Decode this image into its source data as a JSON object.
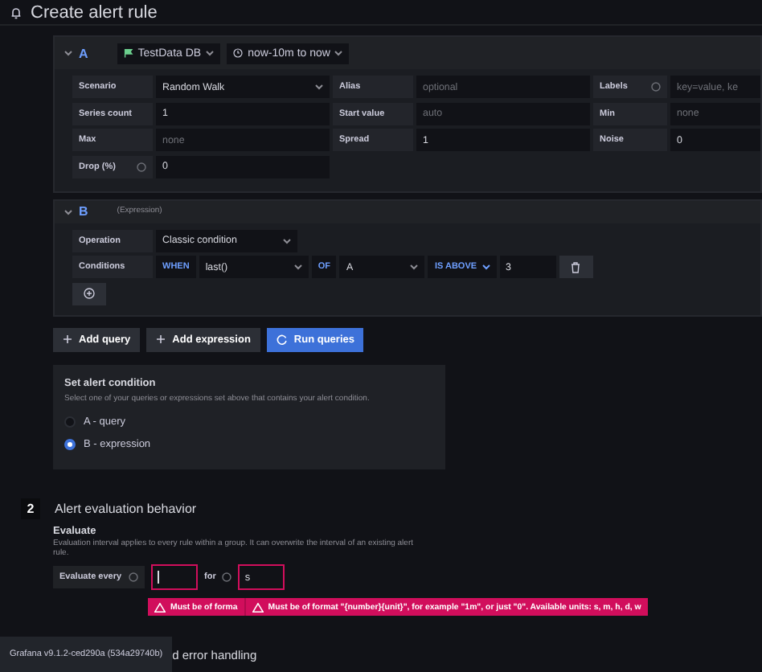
{
  "page_title": "Create alert rule",
  "query": {
    "ref": "A",
    "expanded": true,
    "datasource": "TestData DB",
    "time_range": "now-10m to now",
    "fields": [
      {
        "label": "Scenario",
        "kind": "select",
        "value": "Random Walk"
      },
      {
        "label": "Alias",
        "kind": "input",
        "placeholder": "optional"
      },
      {
        "label": "Labels",
        "kind": "input",
        "info": true,
        "placeholder": "key=value, ke"
      },
      {
        "label": "Series count",
        "kind": "input",
        "value": "1"
      },
      {
        "label": "Start value",
        "kind": "input",
        "placeholder": "auto"
      },
      {
        "label": "Min",
        "kind": "input",
        "placeholder": "none"
      },
      {
        "label": "Max",
        "kind": "input",
        "placeholder": "none"
      },
      {
        "label": "Spread",
        "kind": "input",
        "value": "1"
      },
      {
        "label": "Noise",
        "kind": "input",
        "value": "0"
      },
      {
        "label": "Drop (%)",
        "kind": "input",
        "info": true,
        "value": "0"
      }
    ]
  },
  "expression": {
    "ref": "B",
    "expanded": true,
    "type": "(Expression)",
    "operation_label": "Operation",
    "operation": "Classic condition",
    "conditions_label": "Conditions",
    "condition": {
      "when": "WHEN",
      "reducer": "last()",
      "of": "OF",
      "query": "A",
      "evaluator": "IS ABOVE",
      "threshold": "3"
    }
  },
  "actions": [
    {
      "label": "Add query",
      "kind": "add"
    },
    {
      "label": "Add expression",
      "kind": "add"
    },
    {
      "label": "Run queries",
      "kind": "run"
    }
  ],
  "alert_condition": {
    "title": "Set alert condition",
    "description": "Select one of your queries or expressions set above that contains your alert condition.",
    "options": [
      {
        "label": "A - query",
        "selected": false
      },
      {
        "label": "B - expression",
        "selected": true
      }
    ]
  },
  "evaluation": {
    "step": "2",
    "title": "Alert evaluation behavior",
    "subtitle": "Evaluate",
    "description": "Evaluation interval applies to every rule within a group. It can overwrite the interval of an existing alert rule.",
    "every_label": "Evaluate every",
    "every_invalid": true,
    "for_label": "for",
    "for_value": "s",
    "for_invalid": true,
    "errors": [
      "Must be of forma",
      "Must be of format \"{number}{unit}\", for example \"1m\", or just \"0\". Available units: s, m, h, d, w"
    ]
  },
  "next_section_partial": "d error handling",
  "version_tooltip": "Grafana v9.1.2-ced290a (534a29740b)"
}
